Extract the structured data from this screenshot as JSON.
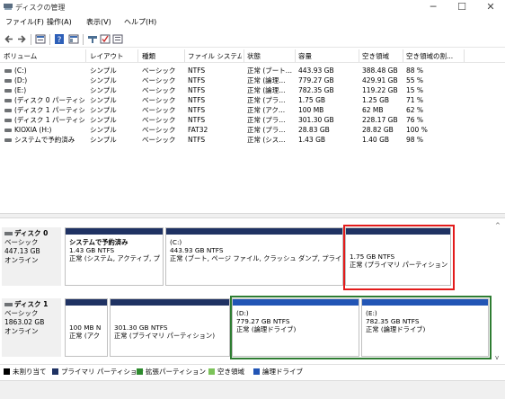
{
  "window": {
    "title": "ディスクの管理",
    "minimize_glyph": "─",
    "maximize_glyph": "☐",
    "close_glyph": "✕"
  },
  "menu": [
    {
      "label": "ファイル(F)"
    },
    {
      "label": "操作(A)"
    },
    {
      "label": "表示(V)"
    },
    {
      "label": "ヘルプ(H)"
    }
  ],
  "toolbar": {
    "icons": [
      "back-arrow-icon",
      "forward-arrow-icon",
      "properties-icon",
      "help-icon",
      "disk-list-icon",
      "connect-icon",
      "check-icon",
      "settings-icon"
    ]
  },
  "volume_table": {
    "headers": [
      "ボリューム",
      "レイアウト",
      "種類",
      "ファイル システム",
      "状態",
      "容量",
      "空き領域",
      "空き領域の割..."
    ],
    "rows": [
      [
        "(C:)",
        "シンプル",
        "ベーシック",
        "NTFS",
        "正常 (ブート...",
        "443.93 GB",
        "388.48 GB",
        "88 %"
      ],
      [
        "(D:)",
        "シンプル",
        "ベーシック",
        "NTFS",
        "正常 (論理...",
        "779.27 GB",
        "429.91 GB",
        "55 %"
      ],
      [
        "(E:)",
        "シンプル",
        "ベーシック",
        "NTFS",
        "正常 (論理...",
        "782.35 GB",
        "119.22 GB",
        "15 %"
      ],
      [
        "(ディスク 0 パーティシ...",
        "シンプル",
        "ベーシック",
        "NTFS",
        "正常 (プラ...",
        "1.75 GB",
        "1.25 GB",
        "71 %"
      ],
      [
        "(ディスク 1 パーティシ...",
        "シンプル",
        "ベーシック",
        "NTFS",
        "正常 (アク...",
        "100 MB",
        "62 MB",
        "62 %"
      ],
      [
        "(ディスク 1 パーティシ...",
        "シンプル",
        "ベーシック",
        "NTFS",
        "正常 (プラ...",
        "301.30 GB",
        "228.17 GB",
        "76 %"
      ],
      [
        "KIOXIA (H:)",
        "シンプル",
        "ベーシック",
        "FAT32",
        "正常 (プラ...",
        "28.83 GB",
        "28.82 GB",
        "100 %"
      ],
      [
        "システムで予約済み",
        "シンプル",
        "ベーシック",
        "NTFS",
        "正常 (シス...",
        "1.43 GB",
        "1.40 GB",
        "98 %"
      ]
    ]
  },
  "disks": [
    {
      "name": "ディスク 0",
      "type": "ベーシック",
      "size": "447.13 GB",
      "status": "オンライン",
      "partitions": [
        {
          "title": "システムで予約済み",
          "size": "1.43 GB NTFS",
          "status": "正常 (システム, アクティブ, プ"
        },
        {
          "title": "(C:)",
          "size": "443.93 GB NTFS",
          "status": "正常 (ブート, ページ ファイル, クラッシュ ダンプ, プライマ!"
        },
        {
          "title": "",
          "size": "1.75 GB NTFS",
          "status": "正常 (プライマリ パーティション"
        }
      ]
    },
    {
      "name": "ディスク 1",
      "type": "ベーシック",
      "size": "1863.02 GB",
      "status": "オンライン",
      "partitions": [
        {
          "title": "",
          "size": "100 MB N",
          "status": "正常 (アク"
        },
        {
          "title": "",
          "size": "301.30 GB NTFS",
          "status": "正常 (プライマリ パーティション)"
        },
        {
          "title": "(D:)",
          "size": "779.27 GB NTFS",
          "status": "正常 (論理ドライブ)"
        },
        {
          "title": "(E:)",
          "size": "782.35 GB NTFS",
          "status": "正常 (論理ドライブ)"
        }
      ]
    }
  ],
  "legend": [
    {
      "label": "未割り当て",
      "color": "#000000"
    },
    {
      "label": "プライマリ パーティション",
      "color": "#1f3263"
    },
    {
      "label": "拡張パーティション",
      "color": "#2e8b2e"
    },
    {
      "label": "空き領域",
      "color": "#7cc35a"
    },
    {
      "label": "論理ドライブ",
      "color": "#2255b5"
    }
  ],
  "highlight_colors": {
    "red": "#e31b1b",
    "green": "#2e7d32"
  },
  "scroll": {
    "up_glyph": "^",
    "down_glyph": "v"
  }
}
